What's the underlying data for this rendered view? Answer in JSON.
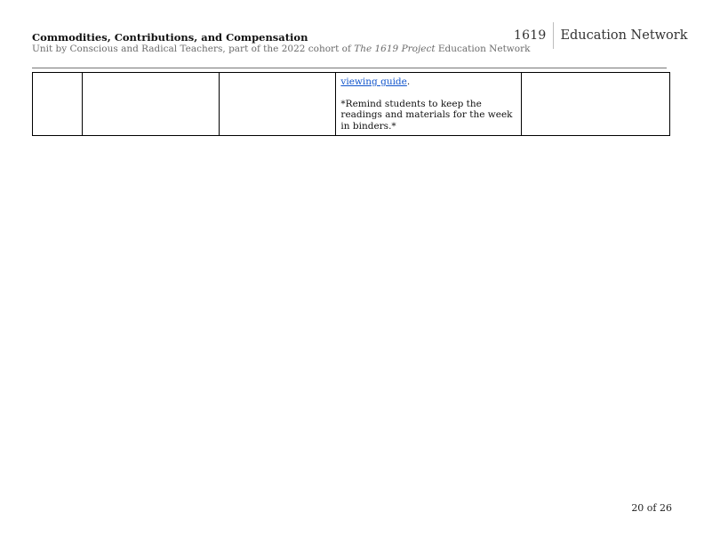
{
  "header": {
    "title": "Commodities, Contributions, and Compensation",
    "subtitle_prefix": "Unit by Conscious and Radical Teachers, part of the 2022 cohort of ",
    "subtitle_italic": "The 1619 Project",
    "subtitle_suffix": " Education Network"
  },
  "logo": {
    "number": "1619",
    "text": "Education Network"
  },
  "table": {
    "row": {
      "cell4_link": "viewing guide",
      "cell4_link_suffix": ".",
      "cell4_note": "*Remind students to keep the readings and materials for the week in binders.*"
    }
  },
  "footer": {
    "page": "20 of 26"
  },
  "colors": {
    "link": "#1155cc",
    "subtitle": "#6b6b6b"
  }
}
